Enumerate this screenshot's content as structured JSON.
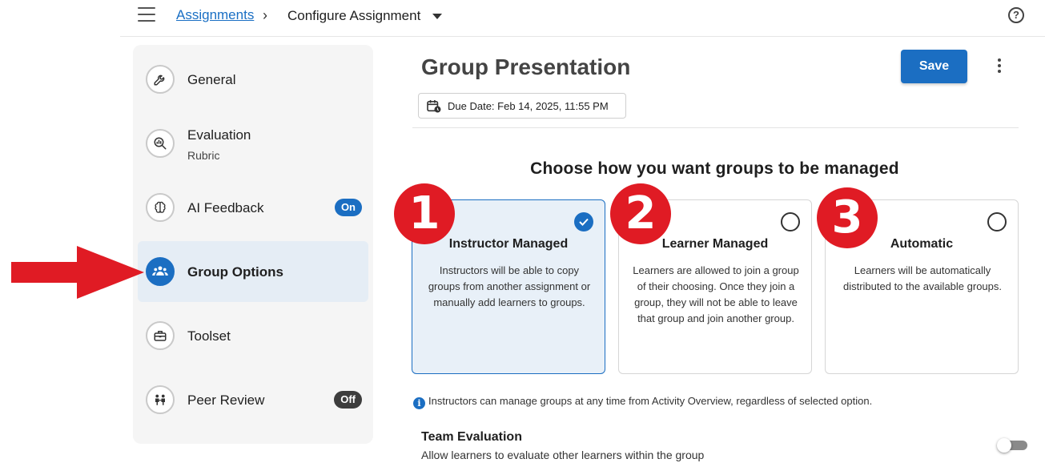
{
  "topbar": {
    "breadcrumb_link": "Assignments",
    "breadcrumb_separator": "›",
    "breadcrumb_current": "Configure Assignment",
    "help_label": "?"
  },
  "sidebar": {
    "items": [
      {
        "label": "General",
        "icon": "wrench-icon"
      },
      {
        "label": "Evaluation",
        "sub": "Rubric",
        "icon": "magnifier-chart-icon"
      },
      {
        "label": "AI Feedback",
        "badge": "On",
        "icon": "brain-icon"
      },
      {
        "label": "Group Options",
        "icon": "group-icon",
        "active": true
      },
      {
        "label": "Toolset",
        "icon": "toolbox-icon"
      },
      {
        "label": "Peer Review",
        "badge": "Off",
        "icon": "people-icon"
      }
    ]
  },
  "main": {
    "title": "Group Presentation",
    "save_label": "Save",
    "due_date": "Due Date: Feb 14, 2025, 11:55 PM",
    "heading": "Choose how you want groups to be managed",
    "options": [
      {
        "number": "1",
        "title": "Instructor Managed",
        "description": "Instructors will be able to copy groups from another assignment or manually add learners to groups.",
        "selected": true
      },
      {
        "number": "2",
        "title": "Learner Managed",
        "description": "Learners are allowed to join a group of their choosing. Once they join a group, they will not be able to leave that group and join another group.",
        "selected": false
      },
      {
        "number": "3",
        "title": "Automatic",
        "description": "Learners will be automatically distributed to the available groups.",
        "selected": false
      }
    ],
    "info_text": "Instructors can manage groups at any time from Activity Overview, regardless of selected option.",
    "team_evaluation": {
      "title": "Team Evaluation",
      "description": "Allow learners to evaluate other learners within the group",
      "enabled": false
    }
  },
  "colors": {
    "accent": "#1b6ec2",
    "annotation_red": "#e01b24",
    "badge_off": "#3d3d3d",
    "selected_card_bg": "#e8f0f8"
  }
}
